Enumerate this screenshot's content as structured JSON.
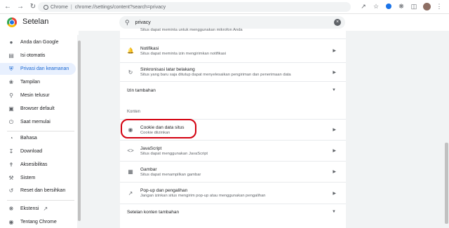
{
  "browser": {
    "chip_label": "Chrome",
    "url": "chrome://settings/content?search=privacy",
    "icons": [
      "back-icon",
      "forward-icon",
      "reload-icon",
      "share-icon",
      "star-icon",
      "extension-icon",
      "puzzle-icon",
      "sidepanel-icon",
      "avatar",
      "menu-icon"
    ]
  },
  "header": {
    "title": "Setelan",
    "search_value": "privacy"
  },
  "sidebar": {
    "items": [
      {
        "label": "Anda dan Google",
        "icon": "person-icon"
      },
      {
        "label": "Isi otomatis",
        "icon": "autofill-icon"
      },
      {
        "label": "Privasi dan keamanan",
        "icon": "shield-icon",
        "active": true
      },
      {
        "label": "Tampilan",
        "icon": "palette-icon"
      },
      {
        "label": "Mesin telusur",
        "icon": "search-icon"
      },
      {
        "label": "Browser default",
        "icon": "browser-icon"
      },
      {
        "label": "Saat memulai",
        "icon": "power-icon"
      },
      {
        "label": "Bahasa",
        "icon": "globe-icon"
      },
      {
        "label": "Download",
        "icon": "download-icon"
      },
      {
        "label": "Aksesibilitas",
        "icon": "accessibility-icon"
      },
      {
        "label": "Sistem",
        "icon": "wrench-icon"
      },
      {
        "label": "Reset dan bersihkan",
        "icon": "reset-icon"
      },
      {
        "label": "Ekstensi",
        "icon": "puzzle-icon"
      },
      {
        "label": "Tentang Chrome",
        "icon": "chrome-icon"
      }
    ]
  },
  "content": {
    "top_cut_text": "Situs dapat meminta untuk menggunakan mikrofon Anda",
    "rows": [
      {
        "title": "Notifikasi",
        "subtitle": "Situs dapat meminta izin mengirimkan notifikasi",
        "icon": "bell-icon"
      },
      {
        "title": "Sinkronisasi latar belakang",
        "subtitle": "Situs yang baru saja ditutup dapat menyelesaikan pengiriman dan penerimaan data",
        "icon": "sync-icon"
      }
    ],
    "more_permissions_label": "Izin tambahan",
    "section_konten": "Konten",
    "content_rows": [
      {
        "title": "Cookie dan data situs",
        "subtitle": "Cookie diizinkan",
        "icon": "cookie-icon"
      },
      {
        "title": "JavaScript",
        "subtitle": "Situs dapat menggunakan JavaScript",
        "icon": "code-icon"
      },
      {
        "title": "Gambar",
        "subtitle": "Situs dapat menampilkan gambar",
        "icon": "image-icon"
      },
      {
        "title": "Pop-up dan pengalihan",
        "subtitle": "Jangan izinkan situs mengirim pop-up atau menggunakan pengalihan",
        "icon": "popup-icon"
      }
    ],
    "more_content_label": "Setelan konten tambahan"
  }
}
